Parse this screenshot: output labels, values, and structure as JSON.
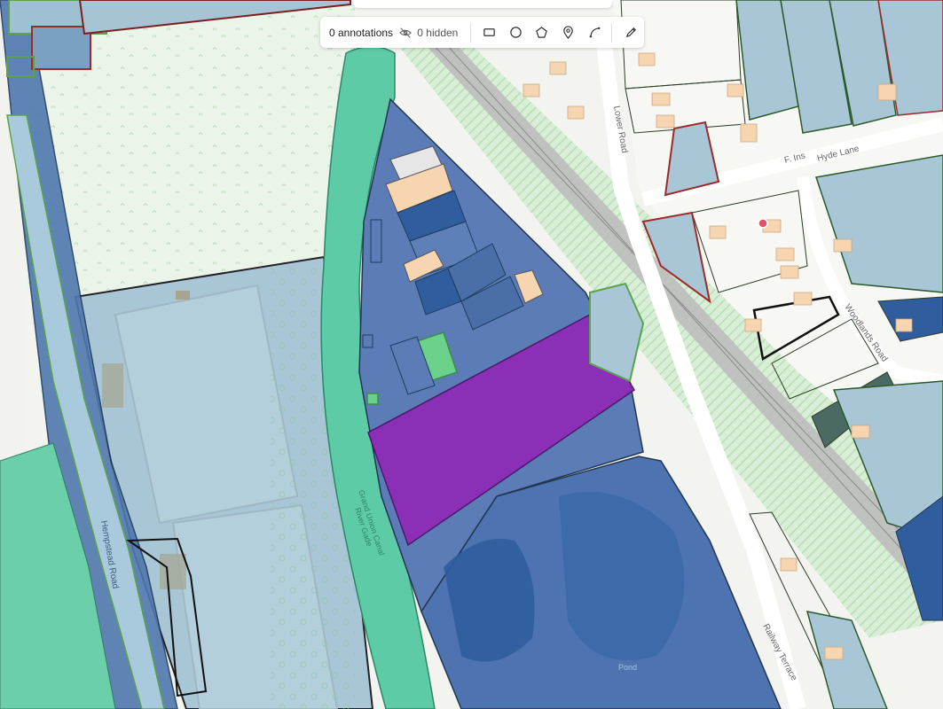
{
  "toolbar": {
    "annotations_label": "0 annotations",
    "hidden_label": "0 hidden",
    "tools": [
      "rectangle-tool",
      "circle-tool",
      "polygon-tool",
      "marker-tool",
      "line-tool",
      "pencil-tool"
    ]
  },
  "map_labels": {
    "lower_road": "Lower Road",
    "hyde_lane": "Hyde Lane",
    "woodlands_road": "Woodlands Road",
    "hempstead_road": "Hempstead Road",
    "canal_1": "Grand Union Canal",
    "canal_2": "River Gade",
    "railway_terrace": "Railway Terrace",
    "pond": "Pond",
    "hyde_lane_prefix": "F. Ins"
  },
  "colors": {
    "canal_green": "#5ecba7",
    "parcel_blue": "#5a7bb5",
    "dark_blue": "#2f5d9e",
    "selected_purple": "#8f2bb8",
    "light_blue": "#a7c7d9",
    "rail_hatch": "#cfe8cf",
    "building_orange": "#f6d5b0"
  }
}
